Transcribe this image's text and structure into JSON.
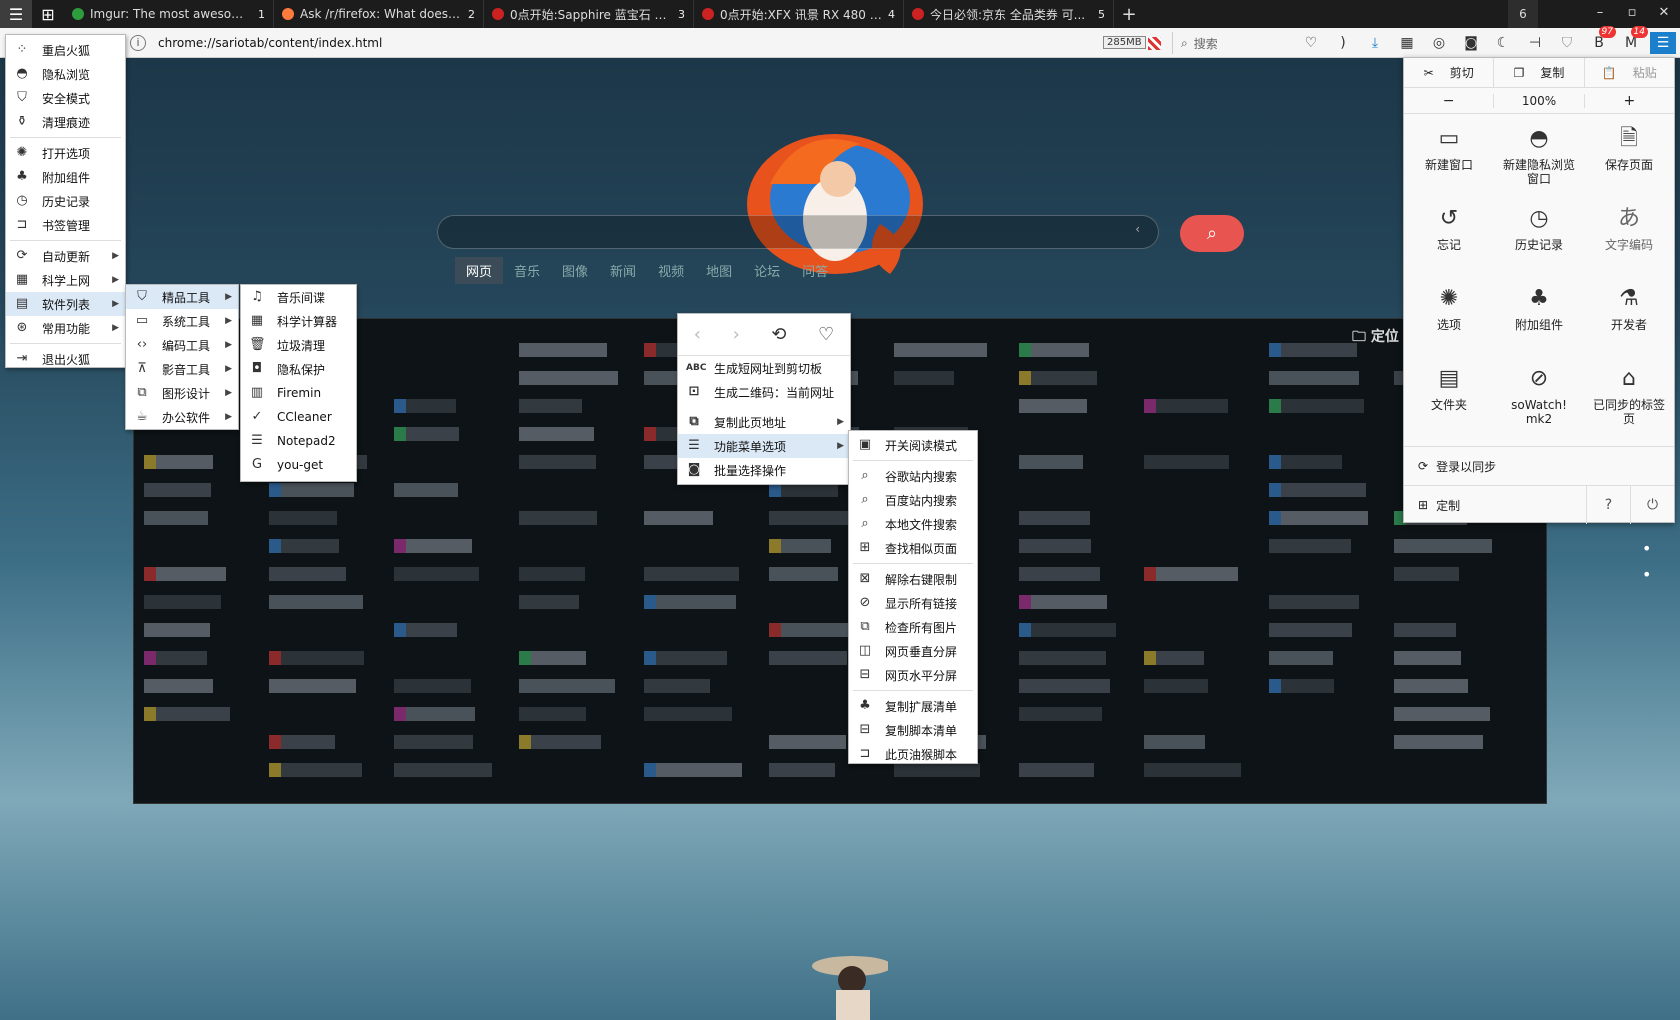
{
  "tabbar": {
    "tabs": [
      {
        "title": "Imgur: The most awesome...",
        "num": "1",
        "color": "#2d9c3c"
      },
      {
        "title": "Ask /r/firefox: What does y...",
        "num": "2",
        "color": "#ff7a3d"
      },
      {
        "title": "0点开始:Sapphire 蓝宝石 R...",
        "num": "3",
        "color": "#cc2222"
      },
      {
        "title": "0点开始:XFX 讯景 RX 480 8...",
        "num": "4",
        "color": "#cc2222"
      },
      {
        "title": "今日必领:京东 全品类券 可...",
        "num": "5",
        "color": "#cc2222"
      }
    ],
    "new_tab": "+",
    "tab_count": "6"
  },
  "urlbar": {
    "url": "chrome://sariotab/content/index.html",
    "memory": "285MB",
    "search_placeholder": "搜索"
  },
  "badges": {
    "b1": "97",
    "b2": "14"
  },
  "page": {
    "nav_tabs": [
      "网页",
      "音乐",
      "图像",
      "新闻",
      "视频",
      "地图",
      "论坛",
      "问答"
    ],
    "locate": "定位"
  },
  "main_menu": [
    {
      "label": "重启火狐",
      "icon": "spinner-icon"
    },
    {
      "label": "隐私浏览",
      "icon": "mask-icon"
    },
    {
      "label": "安全模式",
      "icon": "shield-icon"
    },
    {
      "label": "清理痕迹",
      "icon": "broom-icon"
    },
    {
      "label": "打开选项",
      "icon": "gear-icon"
    },
    {
      "label": "附加组件",
      "icon": "puzzle-icon"
    },
    {
      "label": "历史记录",
      "icon": "clock-icon"
    },
    {
      "label": "书签管理",
      "icon": "bookmark-icon"
    },
    {
      "label": "自动更新",
      "icon": "update-icon"
    },
    {
      "label": "科学上网",
      "icon": "grid-icon"
    },
    {
      "label": "软件列表",
      "icon": "apps-icon"
    },
    {
      "label": "常用功能",
      "icon": "star-icon"
    },
    {
      "label": "退出火狐",
      "icon": "exit-icon"
    }
  ],
  "software_menu": [
    "精品工具",
    "系统工具",
    "编码工具",
    "影音工具",
    "图形设计",
    "办公软件"
  ],
  "tools_menu": [
    "音乐间谍",
    "科学计算器",
    "垃圾清理",
    "隐私保护",
    "Firemin",
    "CCleaner",
    "Notepad2",
    "you-get"
  ],
  "context_menu": [
    "生成短网址到剪切板",
    "生成二维码：当前网址",
    "复制此页地址",
    "功能菜单选项",
    "批量选择操作"
  ],
  "function_menu": [
    "开关阅读模式",
    "谷歌站内搜索",
    "百度站内搜索",
    "本地文件搜索",
    "查找相似页面",
    "解除右键限制",
    "显示所有链接",
    "检查所有图片",
    "网页垂直分屏",
    "网页水平分屏",
    "复制扩展清单",
    "复制脚本清单",
    "此页油猴脚本"
  ],
  "panel": {
    "cut": "剪切",
    "copy": "复制",
    "paste": "粘贴",
    "zoom_out": "−",
    "zoom": "100%",
    "zoom_in": "+",
    "items": [
      {
        "label": "新建窗口",
        "icon": "window-icon",
        "glyph": "▭"
      },
      {
        "label": "新建隐私浏览窗口",
        "icon": "private-icon",
        "glyph": "◓"
      },
      {
        "label": "保存页面",
        "icon": "save-page-icon",
        "glyph": "🗎"
      },
      {
        "label": "忘记",
        "icon": "forget-icon",
        "glyph": "↺"
      },
      {
        "label": "历史记录",
        "icon": "history-icon",
        "glyph": "◷"
      },
      {
        "label": "文字编码",
        "icon": "encoding-icon",
        "glyph": "あ"
      },
      {
        "label": "选项",
        "icon": "options-icon",
        "glyph": "✺"
      },
      {
        "label": "附加组件",
        "icon": "addons-icon",
        "glyph": "♣"
      },
      {
        "label": "开发者",
        "icon": "developer-icon",
        "glyph": "⚗"
      },
      {
        "label": "文件夹",
        "icon": "folder-icon",
        "glyph": "▤"
      },
      {
        "label": "soWatch! mk2",
        "icon": "sowatch-icon",
        "glyph": "⊘"
      },
      {
        "label": "已同步的标签页",
        "icon": "synced-tabs-icon",
        "glyph": "⌂"
      }
    ],
    "sync": "登录以同步",
    "customize": "定制"
  }
}
